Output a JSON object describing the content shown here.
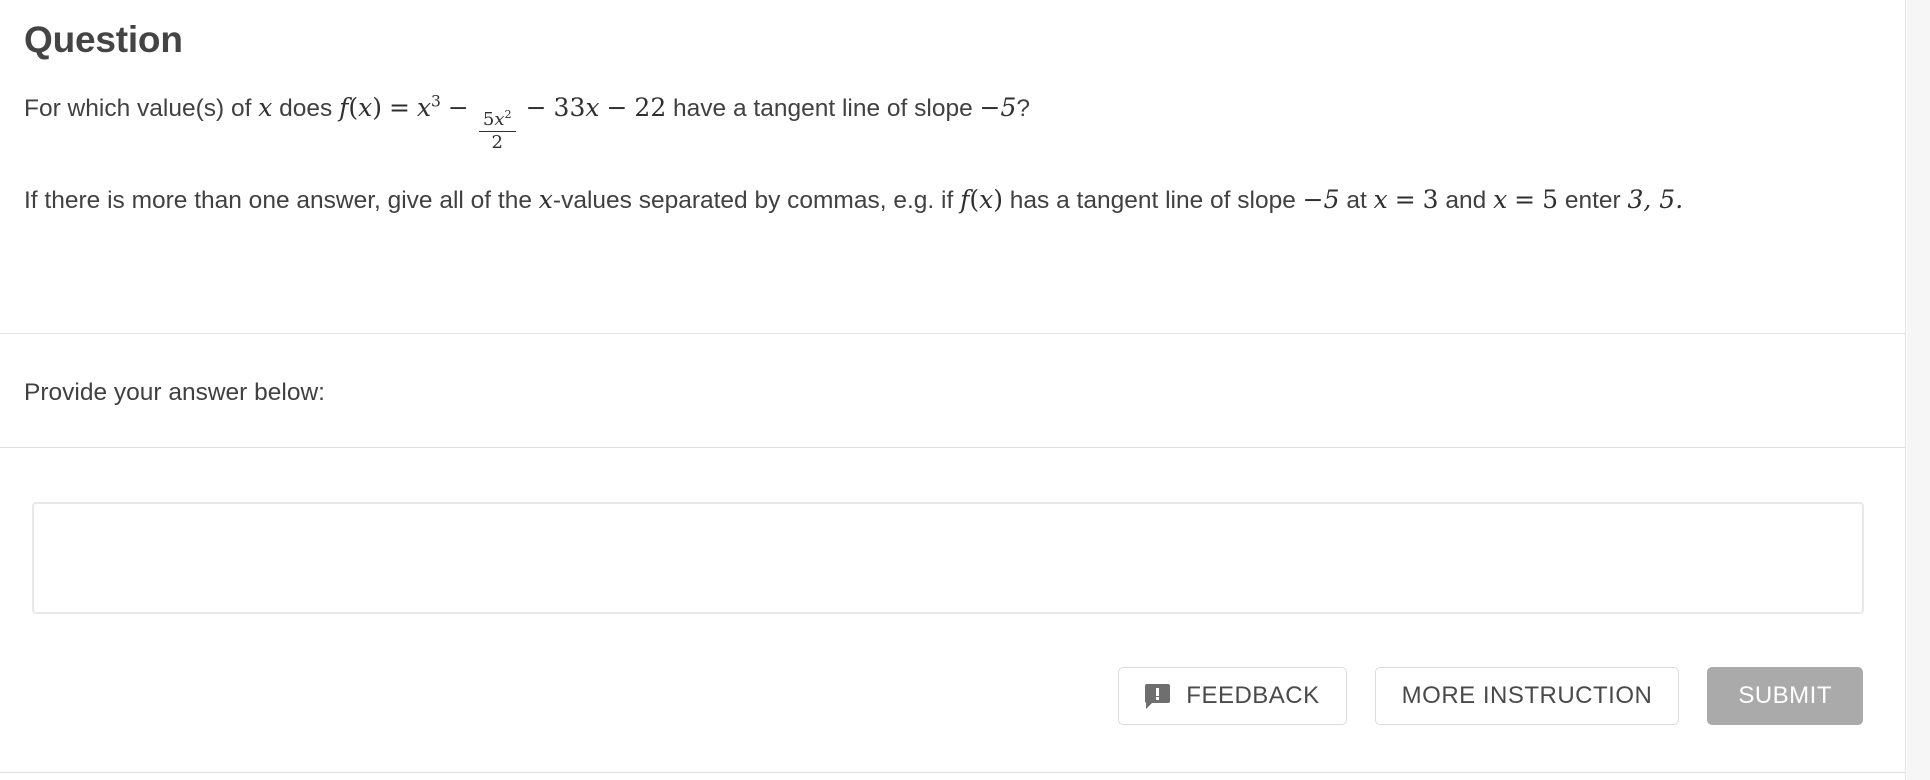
{
  "header": {
    "title": "Question"
  },
  "question": {
    "line1": {
      "prefix": "For which value(s) of",
      "var_x": "x",
      "mid": "does",
      "f_name": "f",
      "f_arg_open": "(",
      "f_arg": "x",
      "f_arg_close": ")",
      "equals": "=",
      "term1_base": "x",
      "term1_exp": "3",
      "op1": "−",
      "frac_num_coef": "5",
      "frac_num_var": "x",
      "frac_num_exp": "2",
      "frac_den": "2",
      "op2": "−",
      "term3_coef": "33",
      "term3_var": "x",
      "op3": "−",
      "term4": "22",
      "suffix": "have a tangent line of slope",
      "slope": "−5",
      "question_mark": "?",
      "full_text": "For which value(s) of x does f(x) = x^3 − 5x^2/2 − 33x − 22 have a tangent line of slope −5?"
    },
    "line2": {
      "part1": "If there is more than one answer, give all of the",
      "var_x": "x",
      "part2": "-values separated by commas, e.g. if",
      "f_name": "f",
      "f_arg_open": "(",
      "f_arg": "x",
      "f_arg_close": ")",
      "part3": "has a tangent line of slope",
      "slope": "−5",
      "part4": "at",
      "eq1_var": "x",
      "eq1_eq": "=",
      "eq1_val": "3",
      "conj": "and",
      "eq2_var": "x",
      "eq2_eq": "=",
      "eq2_val": "5",
      "part5": "enter",
      "answer_example": "3, 5",
      "period": ".",
      "full_text": "If there is more than one answer, give all of the x-values separated by commas, e.g. if f(x) has a tangent line of slope −5 at x = 3 and x = 5 enter 3, 5."
    }
  },
  "answer_section": {
    "prompt": "Provide your answer below:",
    "input_value": "",
    "input_placeholder": ""
  },
  "actions": {
    "feedback_label": "FEEDBACK",
    "feedback_icon": "feedback-bubble-icon",
    "more_instruction_label": "MORE INSTRUCTION",
    "submit_label": "SUBMIT"
  },
  "colors": {
    "heading": "#444444",
    "body_text": "#414141",
    "divider": "#e2e2e2",
    "input_border": "#e8e8e8",
    "button_border": "#dcdcdc",
    "submit_bg": "#aaaaaa",
    "submit_text": "#ffffff",
    "scroll_gutter": "#f6f6f6"
  }
}
